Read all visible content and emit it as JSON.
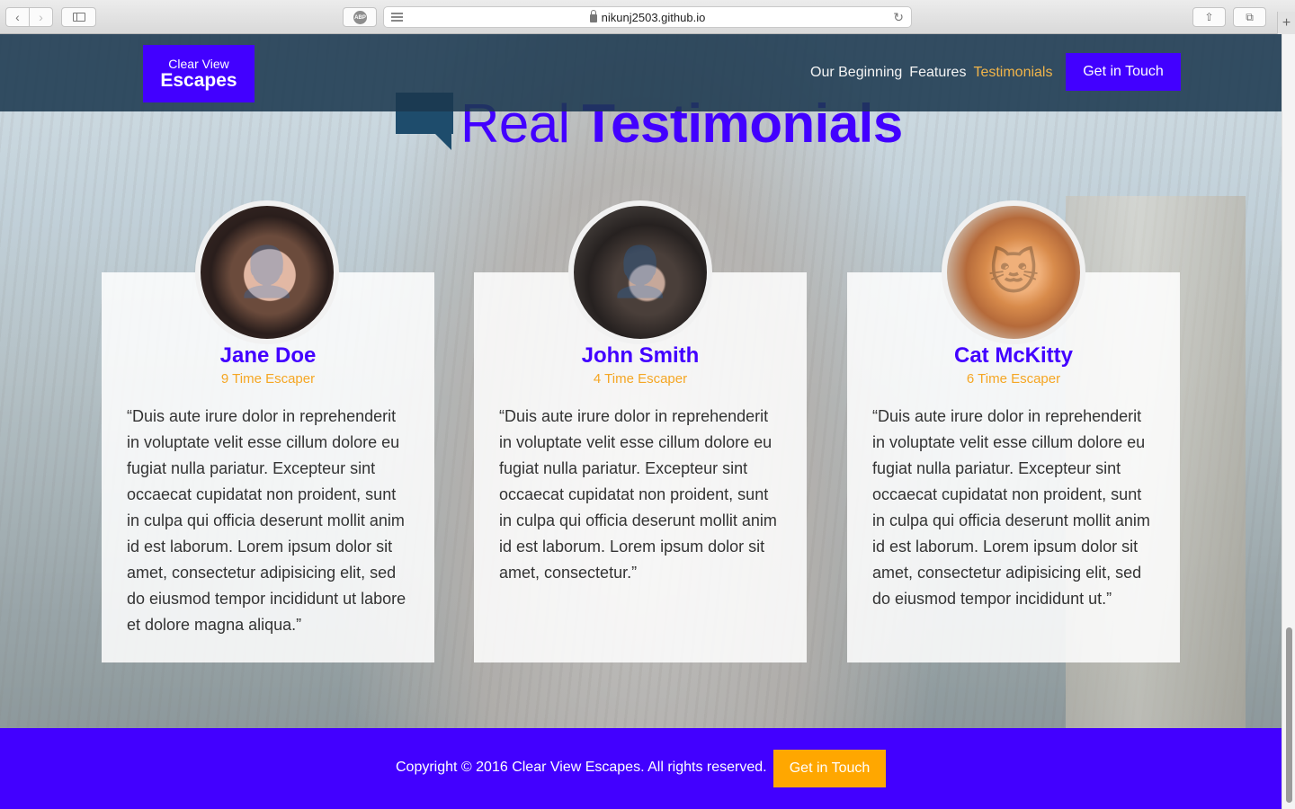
{
  "browser": {
    "url": "nikunj2503.github.io",
    "abp_label": "ABP",
    "back_glyph": "‹",
    "forward_glyph": "›",
    "reload_glyph": "↻",
    "share_glyph": "⇧",
    "tabs_glyph": "⧉",
    "newtab_glyph": "+"
  },
  "nav": {
    "logo_line1": "Clear View",
    "logo_line2": "Escapes",
    "links": [
      "Our Beginning",
      "Features",
      "Testimonials"
    ],
    "active_link": "Testimonials",
    "cta": "Get in Touch",
    "bg_color": "#1b384f",
    "accent_color": "#4200ff"
  },
  "heading": {
    "light": "Real",
    "bold": "Testimonials"
  },
  "testimonials": [
    {
      "name": "Jane Doe",
      "subtitle": "9 Time Escaper",
      "quote": "“Duis aute irure dolor in reprehenderit in voluptate velit esse cillum dolore eu fugiat nulla pariatur. Excepteur sint occaecat cupidatat non proident, sunt in culpa qui officia deserunt mollit anim id est laborum. Lorem ipsum dolor sit amet, consectetur adipisicing elit, sed do eiusmod tempor incididunt ut labore et dolore magna aliqua.”",
      "avatar": "woman-portrait"
    },
    {
      "name": "John Smith",
      "subtitle": "4 Time Escaper",
      "quote": "“Duis aute irure dolor in reprehenderit in voluptate velit esse cillum dolore eu fugiat nulla pariatur. Excepteur sint occaecat cupidatat non proident, sunt in culpa qui officia deserunt mollit anim id est laborum. Lorem ipsum dolor sit amet, consectetur.”",
      "avatar": "man-with-goggles-portrait"
    },
    {
      "name": "Cat McKitty",
      "subtitle": "6 Time Escaper",
      "quote": "“Duis aute irure dolor in reprehenderit in voluptate velit esse cillum dolore eu fugiat nulla pariatur. Excepteur sint occaecat cupidatat non proident, sunt in culpa qui officia deserunt mollit anim id est laborum. Lorem ipsum dolor sit amet, consectetur adipisicing elit, sed do eiusmod tempor incididunt ut.”",
      "avatar": "cat-portrait"
    }
  ],
  "footer": {
    "copyright": "Copyright © 2016 Clear View Escapes. All rights reserved.",
    "cta": "Get in Touch",
    "bg_color": "#4200ff",
    "cta_color": "#ffa700"
  },
  "colors": {
    "name": "#4200ff",
    "subtitle": "#f5a623",
    "active_nav": "#f0b44a"
  }
}
